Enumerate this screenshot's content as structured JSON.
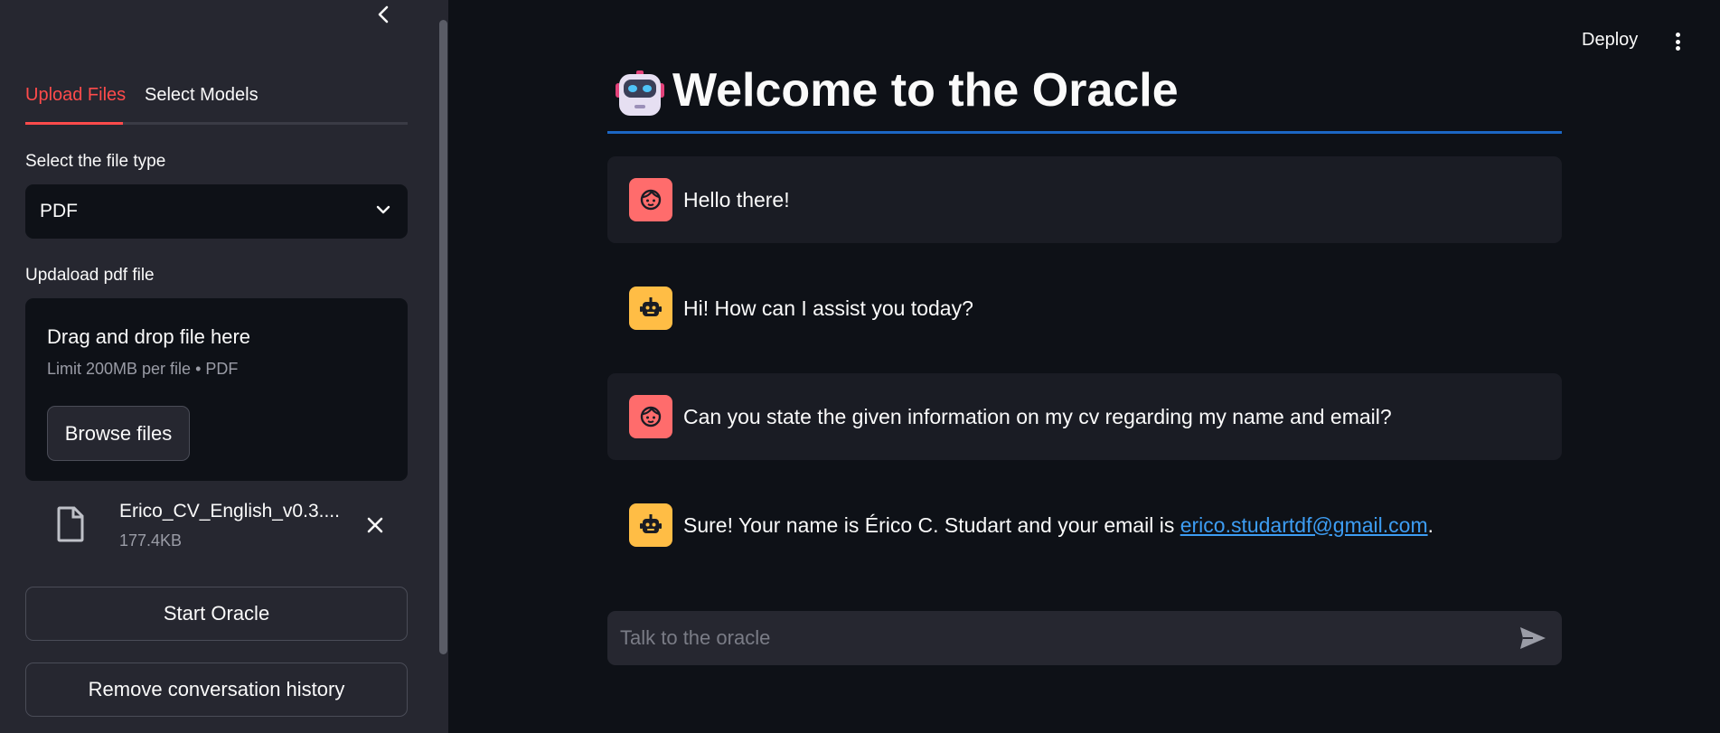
{
  "sidebar": {
    "tabs": [
      {
        "label": "Upload Files",
        "active": true
      },
      {
        "label": "Select Models",
        "active": false
      }
    ],
    "file_type": {
      "label": "Select the file type",
      "selected": "PDF"
    },
    "uploader": {
      "label": "Updaload pdf file",
      "drop_title": "Drag and drop file here",
      "limit": "Limit 200MB per file • PDF",
      "browse_label": "Browse files"
    },
    "file": {
      "name": "Erico_CV_English_v0.3....",
      "size": "177.4KB"
    },
    "start_label": "Start Oracle",
    "remove_label": "Remove conversation history"
  },
  "header": {
    "deploy_label": "Deploy"
  },
  "main": {
    "title": "Welcome to the Oracle",
    "messages": [
      {
        "role": "user",
        "text": "Hello there!"
      },
      {
        "role": "assistant",
        "text": "Hi! How can I assist you today?"
      },
      {
        "role": "user",
        "text": "Can you state the given information on my cv regarding my name and email?"
      },
      {
        "role": "assistant",
        "text_before": "Sure! Your name is Érico C. Studart and your email is ",
        "link": "erico.studartdf@gmail.com",
        "text_after": "."
      }
    ],
    "chat_placeholder": "Talk to the oracle"
  },
  "colors": {
    "accent": "#ff4b4b",
    "background": "#0e1117",
    "sidebar": "#262730",
    "link": "#3d9df3",
    "user_avatar": "#ff6c6c",
    "bot_avatar": "#ffbd45",
    "title_rule": "#1c66c4"
  },
  "icons": [
    "chevron-left-icon",
    "chevron-down-icon",
    "file-icon",
    "close-icon",
    "kebab-menu-icon",
    "robot-icon",
    "user-face-icon",
    "bot-face-icon",
    "send-icon"
  ]
}
